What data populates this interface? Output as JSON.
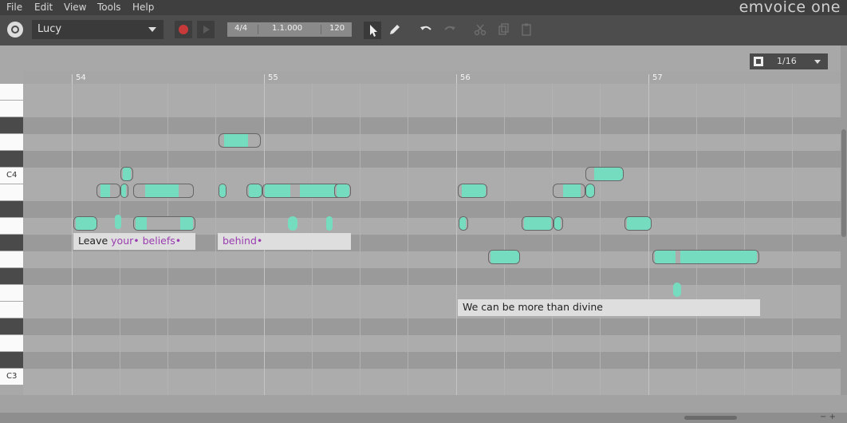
{
  "menu": {
    "file": "File",
    "edit": "Edit",
    "view": "View",
    "tools": "Tools",
    "help": "Help"
  },
  "brand": "emvoice one",
  "toolbar": {
    "voice": "Lucy",
    "time_signature": "4/4",
    "position": "1.1.000",
    "tempo": "120"
  },
  "snap": {
    "value": "1/16"
  },
  "ruler": {
    "bars": [
      "54",
      "55",
      "56",
      "57"
    ]
  },
  "piano": {
    "c4": "C4",
    "c3": "C3"
  },
  "lyrics": {
    "line1": {
      "w1": "Leave ",
      "w2": "your•",
      "w3": " beliefs•"
    },
    "line2": {
      "w1": "behind•"
    },
    "line3": "We can be more than divine"
  },
  "scroll": {
    "zoom": "− +"
  },
  "colors": {
    "note": "#75dcc0",
    "lyric_syllable": "#9a3db0",
    "record": "#c83a3a"
  }
}
